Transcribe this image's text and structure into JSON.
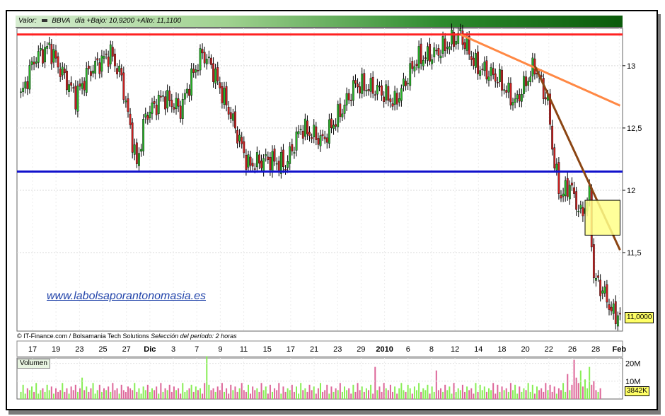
{
  "header": {
    "security_label": "Valor:",
    "ticker": "BBVA",
    "stats": "día +Bajo: 10,9200 +Alto: 11,1100"
  },
  "watermark_text": "www.labolsaporantonomasia.es",
  "footer": {
    "source": "IT-Finance.com / Bolsamania Tech Solutions",
    "period": "Selección del período: 2 horas"
  },
  "volume_label": "Volumen",
  "last_price": "11,0000",
  "last_volume": "3842K",
  "colors": {
    "up": "#27b527",
    "down": "#cc1f1f",
    "resistance": "#ff2222",
    "support": "#1111cc",
    "trend_orange": "#ff8844",
    "trend_brown": "#8b4513",
    "zone": "#ffff88",
    "vol_up": "#88ee55",
    "vol_down": "#dd6699"
  },
  "chart_data": {
    "type": "candlestick",
    "price_axis": {
      "ticks": [
        "13",
        "12,5",
        "12",
        "11,5"
      ],
      "tick_values": [
        13,
        12.5,
        12,
        11.5
      ],
      "ylim": [
        10.87,
        13.3
      ],
      "position": "right"
    },
    "volume_axis": {
      "ticks": [
        "20M",
        "10M"
      ],
      "tick_values": [
        20,
        10
      ],
      "ylim": [
        0,
        23
      ]
    },
    "x_ticks": [
      "17",
      "19",
      "23",
      "25",
      "27",
      "Dic",
      "3",
      "7",
      "9",
      "11",
      "15",
      "17",
      "21",
      "23",
      "29",
      "2010",
      "6",
      "8",
      "12",
      "14",
      "18",
      "20",
      "22",
      "26",
      "28",
      "Feb"
    ],
    "horizontal_lines": [
      {
        "name": "resistance",
        "value": 13.25,
        "color": "#ff2222"
      },
      {
        "name": "support",
        "value": 12.15,
        "color": "#1111cc"
      }
    ],
    "trend_lines": [
      {
        "name": "orange",
        "from": {
          "bar": 201,
          "value": 13.25
        },
        "to": {
          "bar": 274,
          "value": 12.68
        },
        "color": "#ff8844"
      },
      {
        "name": "brown",
        "from": {
          "bar": 235,
          "value": 13.0
        },
        "to": {
          "bar": 274,
          "value": 11.52
        },
        "color": "#8b4513"
      }
    ],
    "zone": {
      "bar_start": 258,
      "bar_end": 274,
      "high": 11.92,
      "low": 11.64,
      "color": "#ffff88"
    },
    "anchors": [
      [
        0,
        12.75
      ],
      [
        6,
        13.05
      ],
      [
        13,
        13.15
      ],
      [
        17,
        13.0
      ],
      [
        25,
        12.75
      ],
      [
        31,
        12.95
      ],
      [
        41,
        13.1
      ],
      [
        46,
        12.9
      ],
      [
        53,
        12.2
      ],
      [
        57,
        12.6
      ],
      [
        65,
        12.75
      ],
      [
        73,
        12.65
      ],
      [
        78,
        12.9
      ],
      [
        83,
        13.1
      ],
      [
        87,
        13.0
      ],
      [
        96,
        12.6
      ],
      [
        104,
        12.2
      ],
      [
        113,
        12.25
      ],
      [
        121,
        12.2
      ],
      [
        128,
        12.5
      ],
      [
        138,
        12.4
      ],
      [
        147,
        12.65
      ],
      [
        153,
        12.85
      ],
      [
        164,
        12.8
      ],
      [
        171,
        12.7
      ],
      [
        181,
        13.05
      ],
      [
        190,
        13.1
      ],
      [
        201,
        13.25
      ],
      [
        208,
        13.0
      ],
      [
        218,
        12.9
      ],
      [
        226,
        12.7
      ],
      [
        235,
        13.0
      ],
      [
        241,
        12.7
      ],
      [
        244,
        12.2
      ],
      [
        247,
        11.95
      ],
      [
        251,
        12.05
      ],
      [
        256,
        11.8
      ],
      [
        260,
        11.95
      ],
      [
        262,
        11.3
      ],
      [
        266,
        11.2
      ],
      [
        271,
        11.0
      ],
      [
        274,
        11.0
      ]
    ],
    "bar_count": 275,
    "volume_values": [
      4,
      8,
      3,
      6,
      5,
      7,
      4,
      9,
      3,
      5,
      6,
      4,
      8,
      5,
      7,
      3,
      6,
      4,
      5,
      9,
      4,
      6,
      3,
      7,
      5,
      8,
      4,
      6,
      12,
      5,
      7,
      4,
      6,
      9,
      3,
      5,
      8,
      4,
      6,
      5,
      7,
      4,
      9,
      5,
      6,
      3,
      8,
      5,
      4,
      7,
      6,
      5,
      9,
      4,
      6,
      3,
      7,
      5,
      8,
      4,
      6,
      5,
      7,
      3,
      9,
      4,
      6,
      5,
      8,
      4,
      7,
      5,
      6,
      3,
      9,
      4,
      5,
      6,
      8,
      4,
      7,
      5,
      6,
      3,
      9,
      24,
      8,
      5,
      6,
      4,
      7,
      5,
      9,
      4,
      6,
      3,
      8,
      5,
      7,
      4,
      6,
      9,
      5,
      4,
      8,
      3,
      7,
      5,
      6,
      4,
      9,
      5,
      7,
      3,
      8,
      4,
      6,
      5,
      9,
      3,
      7,
      4,
      6,
      5,
      8,
      4,
      7,
      3,
      9,
      5,
      6,
      4,
      8,
      5,
      7,
      3,
      6,
      9,
      4,
      5,
      8,
      3,
      7,
      4,
      6,
      5,
      9,
      4,
      7,
      5,
      6,
      3,
      8,
      4,
      9,
      5,
      7,
      4,
      6,
      5,
      8,
      3,
      18,
      5,
      7,
      4,
      9,
      6,
      5,
      8,
      4,
      7,
      3,
      6,
      9,
      5,
      4,
      8,
      6,
      3,
      7,
      5,
      9,
      4,
      6,
      5,
      8,
      3,
      7,
      4,
      16,
      5,
      6,
      4,
      8,
      5,
      7,
      3,
      9,
      4,
      6,
      5,
      8,
      4,
      7,
      5,
      6,
      3,
      9,
      4,
      8,
      5,
      7,
      4,
      6,
      5,
      9,
      3,
      8,
      4,
      7,
      5,
      6,
      4,
      9,
      5,
      8,
      3,
      7,
      4,
      6,
      5,
      9,
      4,
      8,
      3,
      7,
      5,
      6,
      4,
      9,
      5,
      8,
      4,
      7,
      3,
      6,
      5,
      9,
      4,
      14,
      5,
      8,
      22,
      12,
      9,
      16,
      7,
      11,
      6,
      18,
      8,
      10,
      5,
      4,
      6
    ]
  }
}
